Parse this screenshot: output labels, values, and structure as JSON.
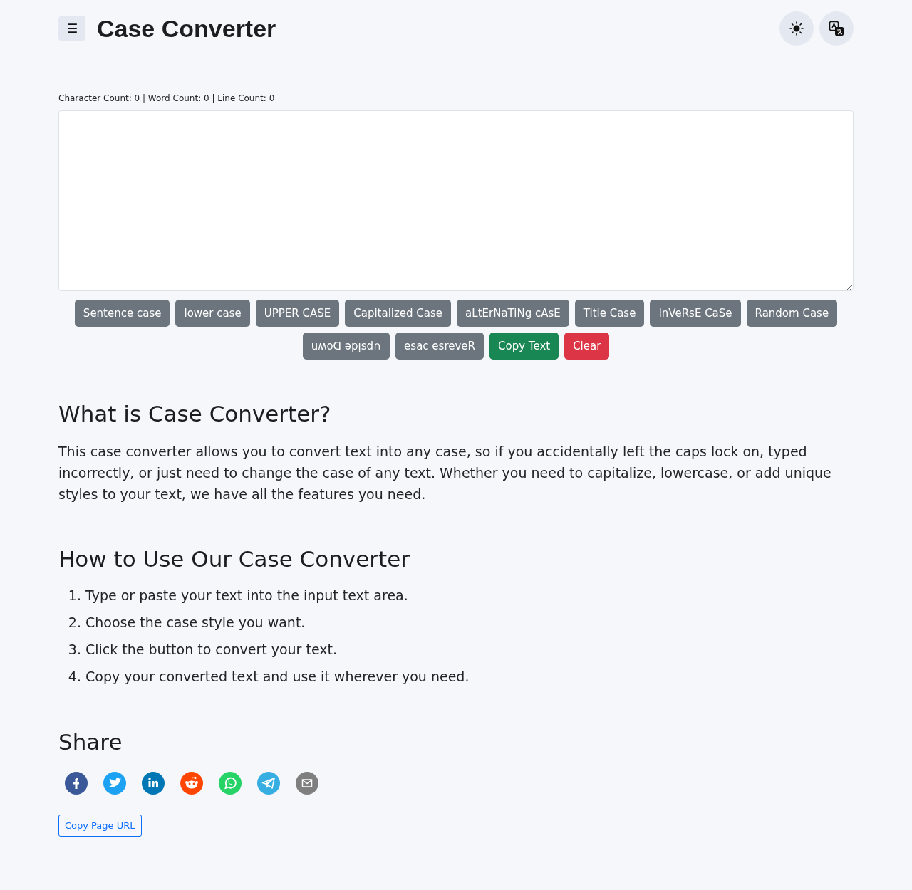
{
  "header": {
    "menu_icon": "☰",
    "title": "Case Converter"
  },
  "counts": "Character Count: 0 | Word Count: 0 | Line Count: 0",
  "buttons": [
    {
      "label": "Sentence case",
      "kind": "convert"
    },
    {
      "label": "lower case",
      "kind": "convert"
    },
    {
      "label": "UPPER CASE",
      "kind": "convert"
    },
    {
      "label": "Capitalized Case",
      "kind": "convert"
    },
    {
      "label": "aLtErNaTiNg cAsE",
      "kind": "convert"
    },
    {
      "label": "Title Case",
      "kind": "convert"
    },
    {
      "label": "InVeRsE CaSe",
      "kind": "convert"
    },
    {
      "label": "Random Case",
      "kind": "convert"
    },
    {
      "label": "uʍoᗡ ǝpᴉsd∩",
      "kind": "convert"
    },
    {
      "label": "esac esreveR",
      "kind": "convert"
    },
    {
      "label": "Copy Text",
      "kind": "copy"
    },
    {
      "label": "Clear",
      "kind": "clear"
    }
  ],
  "about": {
    "heading": "What is Case Converter?",
    "text": "This case converter allows you to convert text into any case, so if you accidentally left the caps lock on, typed incorrectly, or just need to change the case of any text. Whether you need to capitalize, lowercase, or add unique styles to your text, we have all the features you need."
  },
  "howto": {
    "heading": "How to Use Our Case Converter",
    "steps": [
      {
        "number": "1.",
        "text": "Type or paste your text into the input text area."
      },
      {
        "number": "2.",
        "text": "Choose the case style you want."
      },
      {
        "number": "3.",
        "text": "Click the button to convert your text."
      },
      {
        "number": "4.",
        "text": "Copy your converted text and use it wherever you need."
      }
    ]
  },
  "share": {
    "heading": "Share",
    "networks": [
      {
        "kind": "facebook"
      },
      {
        "kind": "twitter"
      },
      {
        "kind": "linkedin"
      },
      {
        "kind": "reddit"
      },
      {
        "kind": "whatsapp"
      },
      {
        "kind": "telegram"
      },
      {
        "kind": "email"
      }
    ],
    "copy_button": "Copy Page URL"
  }
}
